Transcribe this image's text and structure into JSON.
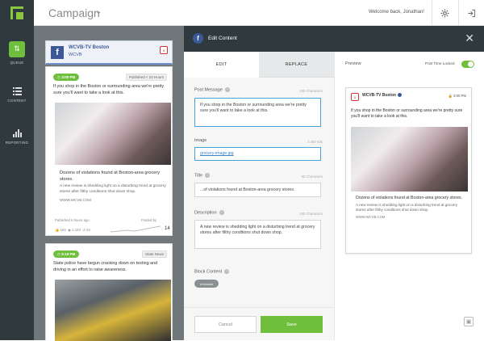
{
  "app": {
    "title": "Campaign",
    "welcome": "Welcome back, Jonathan!"
  },
  "sidebar": {
    "items": [
      {
        "label": "QUEUE",
        "icon": "queue-icon"
      },
      {
        "label": "CONTENT",
        "icon": "content-list-icon"
      },
      {
        "label": "REPORTING",
        "icon": "bar-chart-icon"
      }
    ]
  },
  "queue": {
    "channel": {
      "name": "WCVB-TV Boston",
      "handle": "WCVB"
    },
    "post1": {
      "time": "3:00 PM",
      "status": "Published < 24 Hours",
      "message": "If you shop in the Boston or surrounding area we're pretty sure you'll want to take a look at this.",
      "link_title": "Dozens of violations found at Boston-area grocery stores.",
      "link_desc": "A new review is shedding light on a disturbing trend at grocery stores after filthy conditions shut down shop.",
      "link_url": "WWW.WCVB.COM",
      "meta_left": "Published 6 hours ago",
      "meta_right": "Posted by",
      "stats": [
        "184",
        "1,420",
        "23"
      ],
      "stat_total": "14"
    },
    "post2": {
      "time": "5:19 PM",
      "status": "State News",
      "message": "State police have begun cracking down on texting and driving in an effort to raise awareness."
    }
  },
  "editor": {
    "title": "Edit Content",
    "tabs": [
      "EDIT",
      "REPLACE"
    ],
    "post_message": {
      "label": "Post Message",
      "count": "150 Characters",
      "value": "If you shop in the Boston or surrounding area we're pretty sure you'll want to take a look at this."
    },
    "image": {
      "label": "Image",
      "count": "2,460 Kbs",
      "value": "grocery-image.jpg"
    },
    "title_field": {
      "label": "Title",
      "count": "60 Characters",
      "value": "...of violations found at Boston-area grocery stores."
    },
    "description": {
      "label": "Description",
      "count": "150 Characters",
      "value": "A new review is shedding light on a disturbing trend at grocery stores after filthy conditions shut down shop."
    },
    "block_content": {
      "label": "Block Content",
      "state": "Unlocked"
    },
    "cancel_label": "Cancel",
    "save_label": "Save"
  },
  "preview": {
    "label": "Preview",
    "lock_label": "Post Time Locked",
    "name": "WCVB-TV Boston",
    "time": "3:00 PM",
    "message": "If you shop in the Boston or surrounding area we're pretty sure you'll want to take a look at this.",
    "link_title": "Dozens of violations found at Boston-area grocery stores.",
    "link_desc": "A new review is shedding light on a disturbing trend at grocery stores after filthy conditions shut down shop.",
    "link_url": "WWW.WCVB.COM"
  },
  "colors": {
    "accent_green": "#6fbf3c",
    "dark": "#2f3a3f",
    "facebook": "#3b5998"
  }
}
